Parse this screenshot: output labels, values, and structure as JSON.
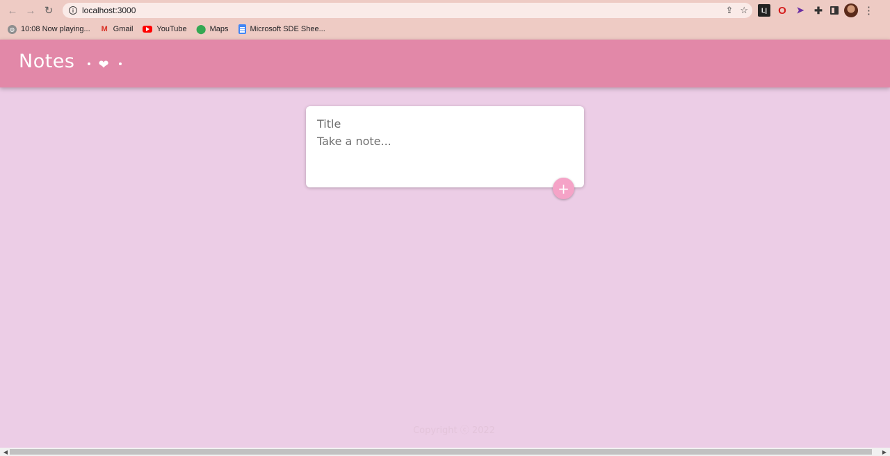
{
  "browser": {
    "url": "localhost:3000",
    "nav": {
      "back": "←",
      "forward": "→",
      "reload": "↻"
    },
    "omnibox_icons": [
      "share-icon",
      "star-icon"
    ],
    "extensions": [
      "lastpass-icon",
      "opera-icon",
      "cursor-icon",
      "puzzle-icon",
      "side-panel-icon"
    ],
    "bookmarks": [
      {
        "label": "10:08 Now playing...",
        "icon": "globe-icon"
      },
      {
        "label": "Gmail",
        "icon": "gmail-icon"
      },
      {
        "label": "YouTube",
        "icon": "youtube-icon"
      },
      {
        "label": "Maps",
        "icon": "maps-icon"
      },
      {
        "label": "Microsoft SDE Shee...",
        "icon": "docs-icon"
      }
    ]
  },
  "app": {
    "title": "Notes",
    "header_color": "#e288a8",
    "background_color": "#eccde6"
  },
  "form": {
    "title_placeholder": "Title",
    "content_placeholder": "Take a note...",
    "add_label": "+",
    "add_color": "#f5a3c7"
  },
  "footer": {
    "text": "Copyright ⓒ 2022"
  }
}
